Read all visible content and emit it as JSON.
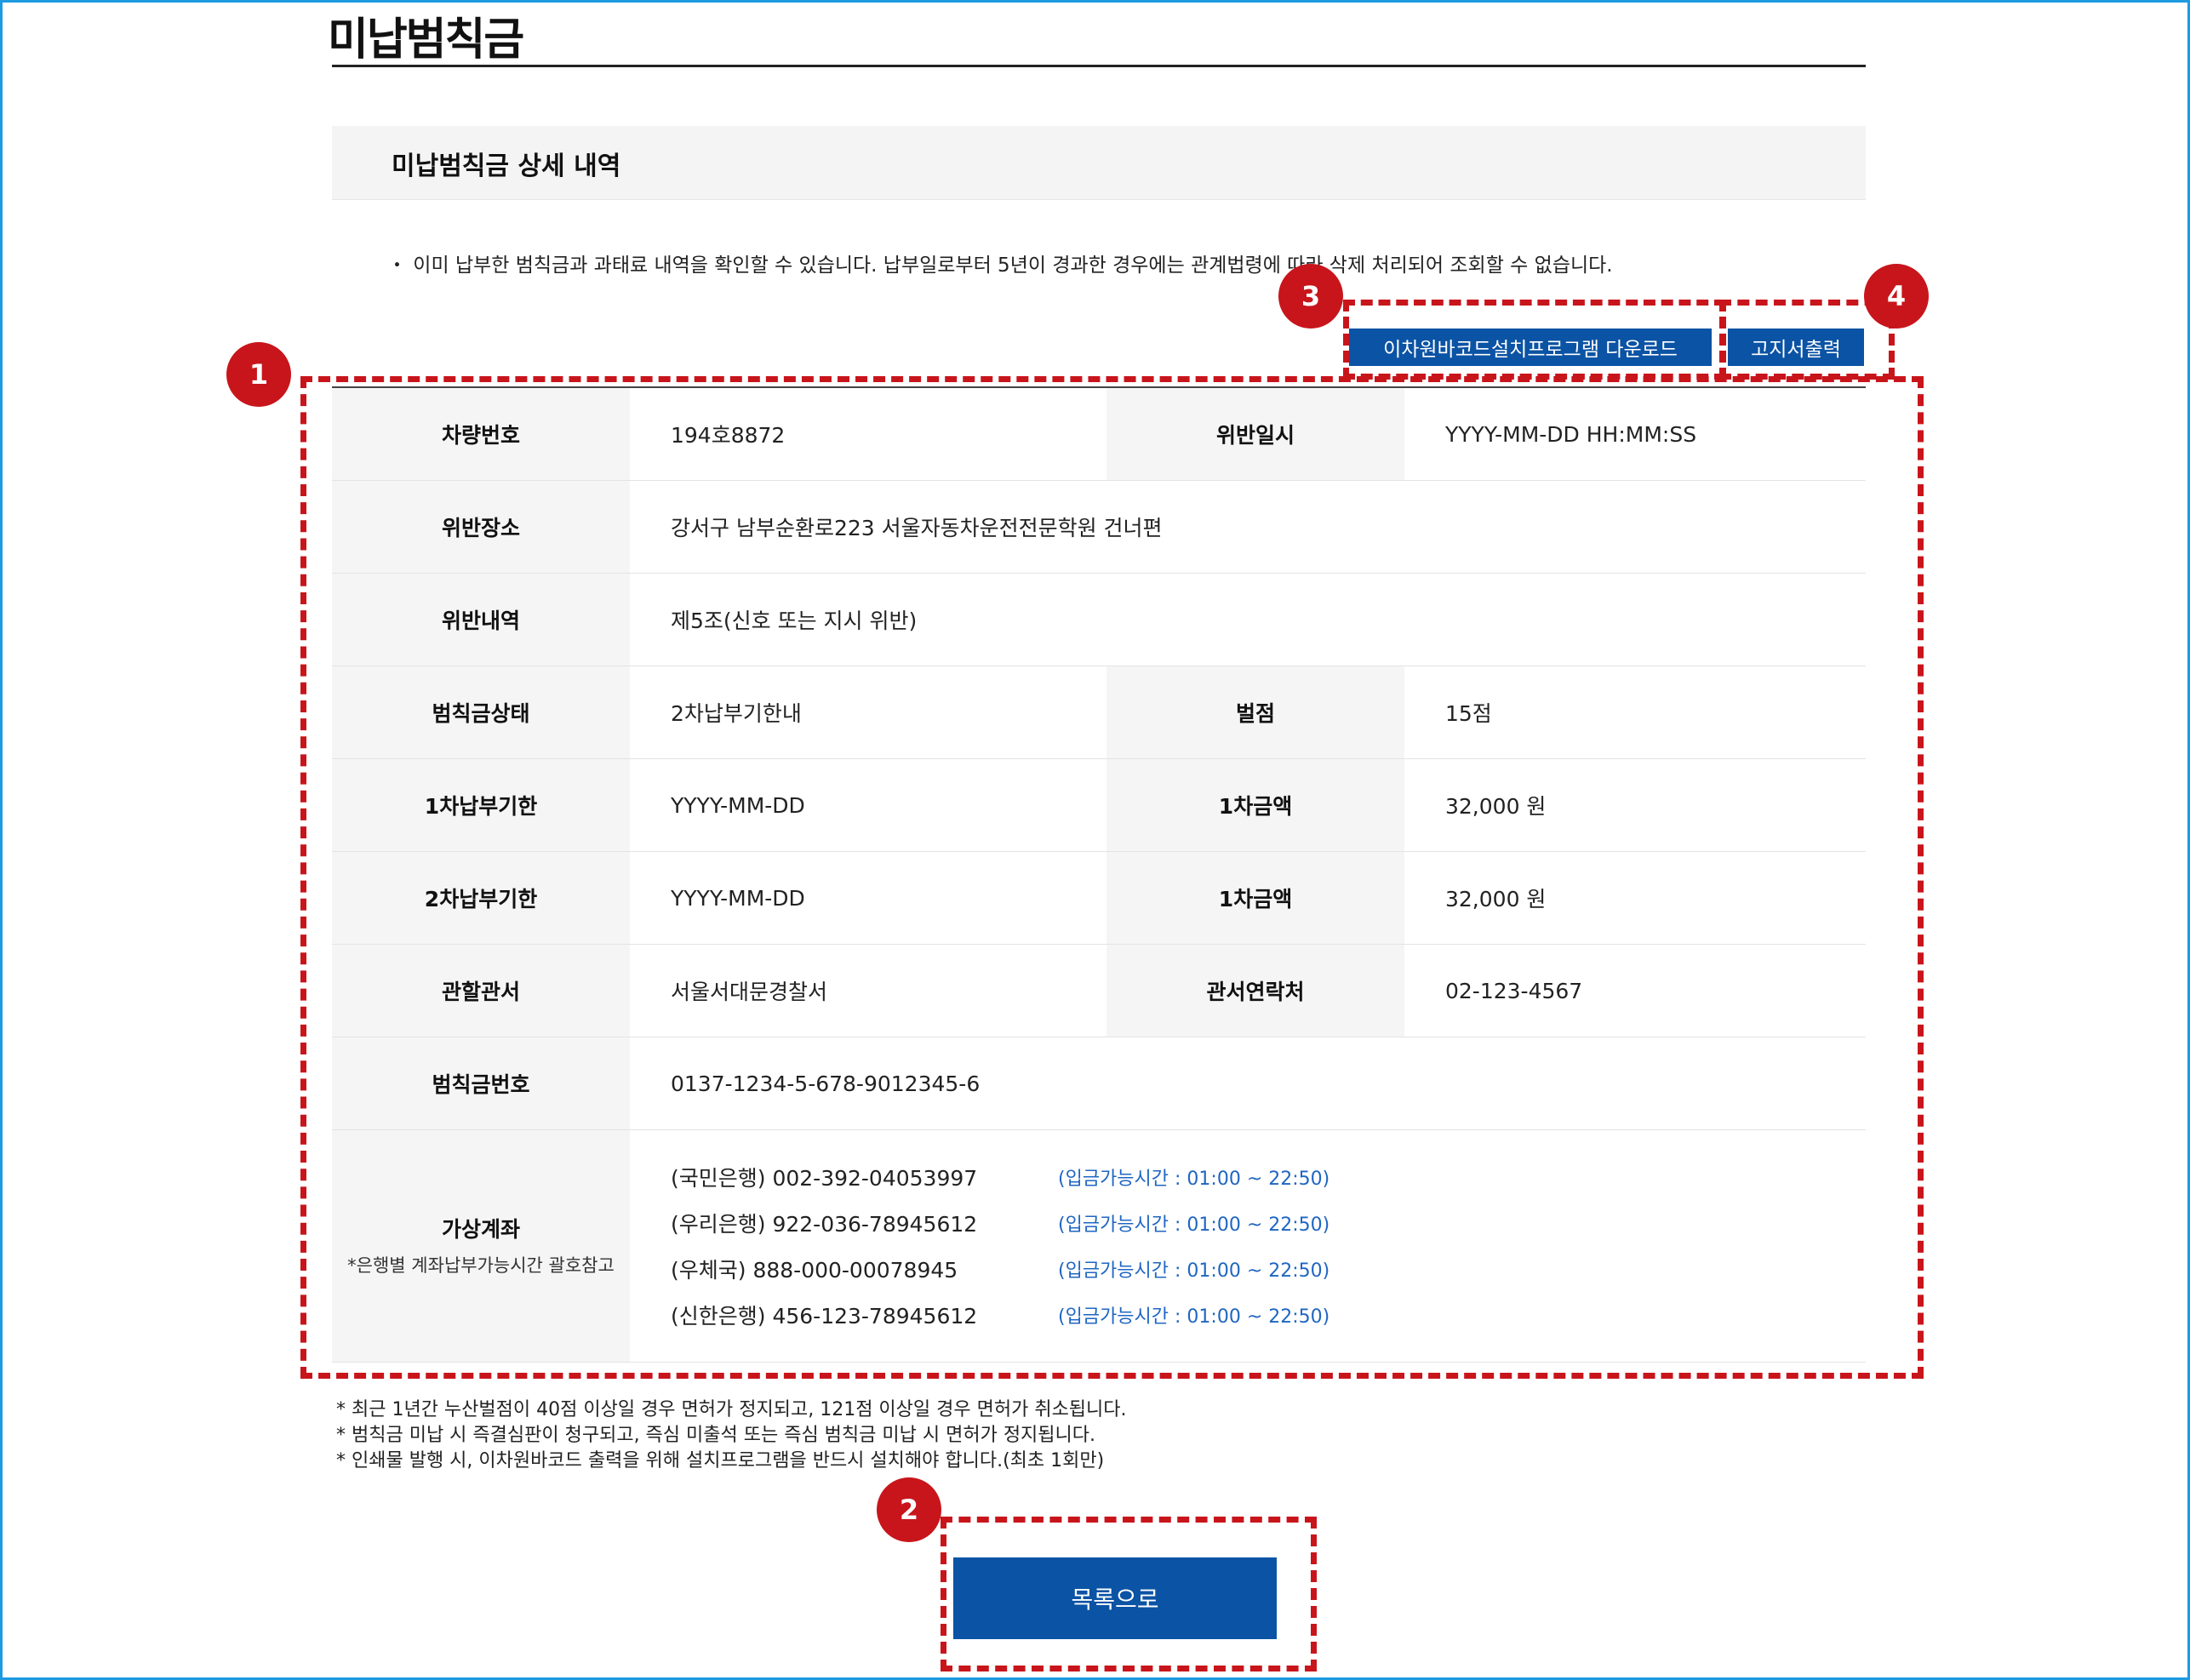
{
  "page": {
    "title": "미납범칙금"
  },
  "section": {
    "title": "미납범칙금  상세 내역"
  },
  "notice": "・ 이미 납부한 범칙금과 과태료 내역을 확인할 수 있습니다. 납부일로부터 5년이 경과한 경우에는 관계법령에 따라 삭제 처리되어 조회할 수 없습니다.",
  "buttons": {
    "barcode_download": "이차원바코드설치프로그램 다운로드",
    "print_notice": "고지서출력",
    "back_to_list": "목록으로"
  },
  "detail": {
    "vehicle_no_label": "차량번호",
    "vehicle_no": "194호8872",
    "violation_datetime_label": "위반일시",
    "violation_datetime": "YYYY-MM-DD HH:MM:SS",
    "violation_place_label": "위반장소",
    "violation_place": "강서구 남부순환로223 서울자동차운전전문학원 건너편",
    "violation_detail_label": "위반내역",
    "violation_detail": "제5조(신호 또는 지시 위반)",
    "fine_status_label": "범칙금상태",
    "fine_status": "2차납부기한내",
    "penalty_points_label": "벌점",
    "penalty_points": "15점",
    "first_deadline_label": "1차납부기한",
    "first_deadline": "YYYY-MM-DD",
    "first_amount_label": "1차금액",
    "first_amount": "32,000 원",
    "second_deadline_label": "2차납부기한",
    "second_deadline": "YYYY-MM-DD",
    "second_amount_label": "1차금액",
    "second_amount": "32,000 원",
    "police_office_label": "관할관서",
    "police_office": "서울서대문경찰서",
    "office_contact_label": "관서연락처",
    "office_contact": "02-123-4567",
    "fine_number_label": "범칙금번호",
    "fine_number": "0137-1234-5-678-9012345-6",
    "virtual_account_label": "가상계좌",
    "virtual_account_note": "*은행별 계좌납부가능시간 괄호참고",
    "accounts": [
      {
        "account": "(국민은행) 002-392-04053997",
        "hours": "(입금가능시간 : 01:00 ~ 22:50)"
      },
      {
        "account": "(우리은행) 922-036-78945612",
        "hours": "(입금가능시간 : 01:00 ~ 22:50)"
      },
      {
        "account": "(우체국) 888-000-00078945",
        "hours": "(입금가능시간 : 01:00 ~ 22:50)"
      },
      {
        "account": "(신한은행) 456-123-78945612",
        "hours": "(입금가능시간 : 01:00 ~ 22:50)"
      }
    ]
  },
  "footnotes": [
    "* 최근 1년간 누산벌점이 40점 이상일 경우 면허가 정지되고, 121점 이상일 경우 면허가 취소됩니다.",
    "* 범칙금 미납 시 즉결심판이 청구되고, 즉심 미출석 또는 즉심 범칙금 미납 시 면허가 정지됩니다.",
    "* 인쇄물 발행 시, 이차원바코드 출력을 위해 설치프로그램을 반드시 설치해야 합니다.(최초 1회만)"
  ],
  "annotations": {
    "badge_1": "1",
    "badge_2": "2",
    "badge_3": "3",
    "badge_4": "4",
    "color": "#c8151b"
  },
  "colors": {
    "primary_button": "#0b53a4",
    "frame": "#1e9be0",
    "account_hours": "#1f66c2"
  }
}
